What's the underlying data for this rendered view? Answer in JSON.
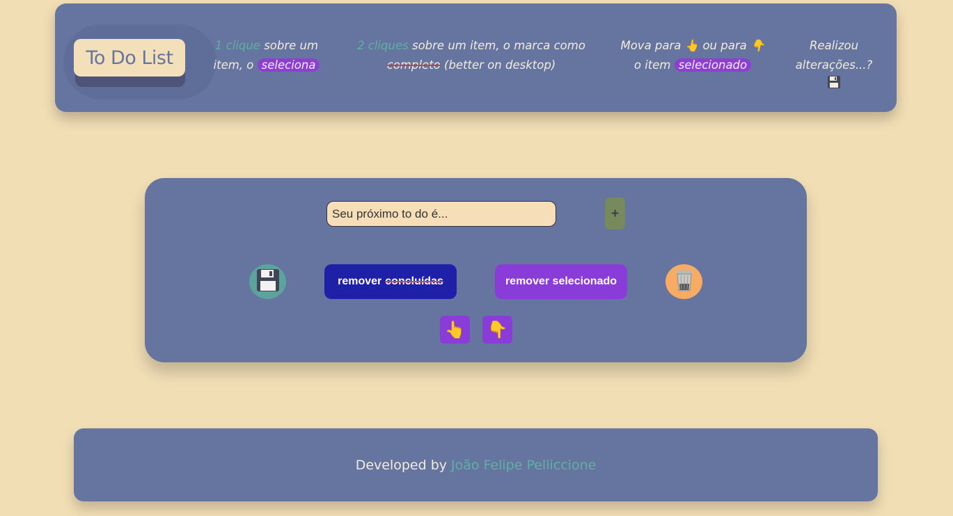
{
  "header": {
    "logo": "To Do List",
    "hint1": {
      "highlight": "1 clique",
      "text1": " sobre um",
      "text2": "item, o ",
      "pill": "seleciona"
    },
    "hint2": {
      "highlight": "2 cliques",
      "text1": " sobre um item, o marca como",
      "strike": "completo",
      "text2": " (better on desktop)"
    },
    "hint3": {
      "text1": "Mova para ",
      "up_emoji": "👆",
      "text2": " ou para ",
      "down_emoji": "👇",
      "text3": "o item ",
      "pill": "selecionado"
    },
    "hint4": {
      "line1": "Realizou",
      "line2": "alterações...?"
    }
  },
  "panel": {
    "input_placeholder": "Seu próximo to do é...",
    "add_label": "+",
    "remove_done_prefix": "remover",
    "remove_done_strike": "concluídas",
    "remove_selected_label": "remover selecionado",
    "trash_emoji": "🗑️",
    "move_up_emoji": "👆",
    "move_down_emoji": "👇"
  },
  "footer": {
    "prefix": "Developed by",
    "author": "João Felipe Pelliccione"
  },
  "colors": {
    "background": "#f1deb5",
    "card": "#6675a0",
    "accent_teal": "#5eb0a0",
    "accent_purple": "#8a3cd8",
    "remove_done": "#1e21a8",
    "add_button": "#768a5b",
    "save_button": "#5ba39c",
    "trash_button": "#f8ab62"
  }
}
